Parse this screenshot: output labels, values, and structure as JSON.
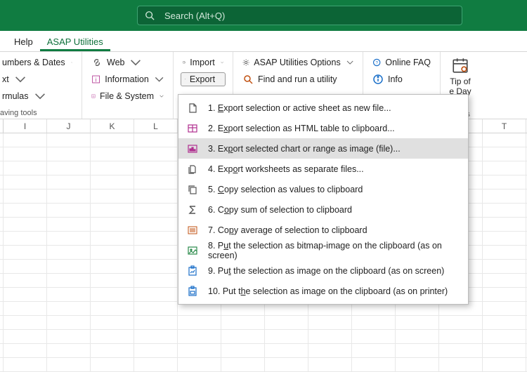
{
  "search": {
    "placeholder": "Search (Alt+Q)"
  },
  "tabs": {
    "help": "Help",
    "asap": "ASAP Utilities"
  },
  "ribbon": {
    "group1": {
      "numbersDates": "umbers & Dates",
      "text": "xt",
      "formulas": "rmulas",
      "label": "aving tools"
    },
    "group2": {
      "web": "Web",
      "information": "Information",
      "fileSystem": "File & System"
    },
    "group3": {
      "import": "Import",
      "export": "Export"
    },
    "group4": {
      "options": "ASAP Utilities Options",
      "find": "Find and run a utility"
    },
    "group5": {
      "faq": "Online FAQ",
      "info": "Info"
    },
    "group6": {
      "tip": "Tip of",
      "day": "e Day",
      "label": "tricks"
    }
  },
  "menu": {
    "i1_pre": "1.  ",
    "i1_u": "E",
    "i1_post": "xport selection or active sheet as new file...",
    "i2_pre": "2.  E",
    "i2_u": "x",
    "i2_post": "port selection as HTML table to clipboard...",
    "i3_pre": "3.  Ex",
    "i3_u": "p",
    "i3_post": "ort selected chart or range as image (file)...",
    "i4_pre": "4.  Exp",
    "i4_u": "o",
    "i4_post": "rt worksheets as separate files...",
    "i5_pre": "5.  ",
    "i5_u": "C",
    "i5_post": "opy selection as values to clipboard",
    "i6_pre": "6.  C",
    "i6_u": "o",
    "i6_post": "py sum of selection to clipboard",
    "i7_pre": "7.  Co",
    "i7_u": "p",
    "i7_post": "y average of selection to clipboard",
    "i8_pre": "8.  P",
    "i8_u": "u",
    "i8_post": "t the selection as bitmap-image on the clipboard (as on screen)",
    "i9_pre": "9.  Pu",
    "i9_u": "t",
    "i9_post": " the selection as image on the clipboard (as on screen)",
    "i10_pre": "10.  Put t",
    "i10_u": "h",
    "i10_post": "e selection as image on the clipboard (as on printer)"
  },
  "cols": [
    "I",
    "J",
    "K",
    "L",
    "",
    "",
    "",
    "",
    "",
    "",
    "",
    "T"
  ]
}
